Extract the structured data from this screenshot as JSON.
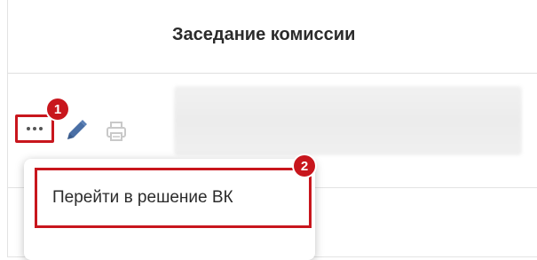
{
  "table": {
    "column_header": "Заседание комиссии"
  },
  "row_actions": {
    "more_icon": "ellipsis-icon",
    "edit_icon": "pencil-icon",
    "print_icon": "printer-icon"
  },
  "annotations": {
    "badge_1": "1",
    "badge_2": "2",
    "color": "#c8161d"
  },
  "context_menu": {
    "items": [
      {
        "label": "Перейти в решение ВК"
      }
    ]
  },
  "colors": {
    "highlight": "#c8161d",
    "edit_icon": "#4a6fa5",
    "print_icon_disabled": "#c9c9c9"
  }
}
